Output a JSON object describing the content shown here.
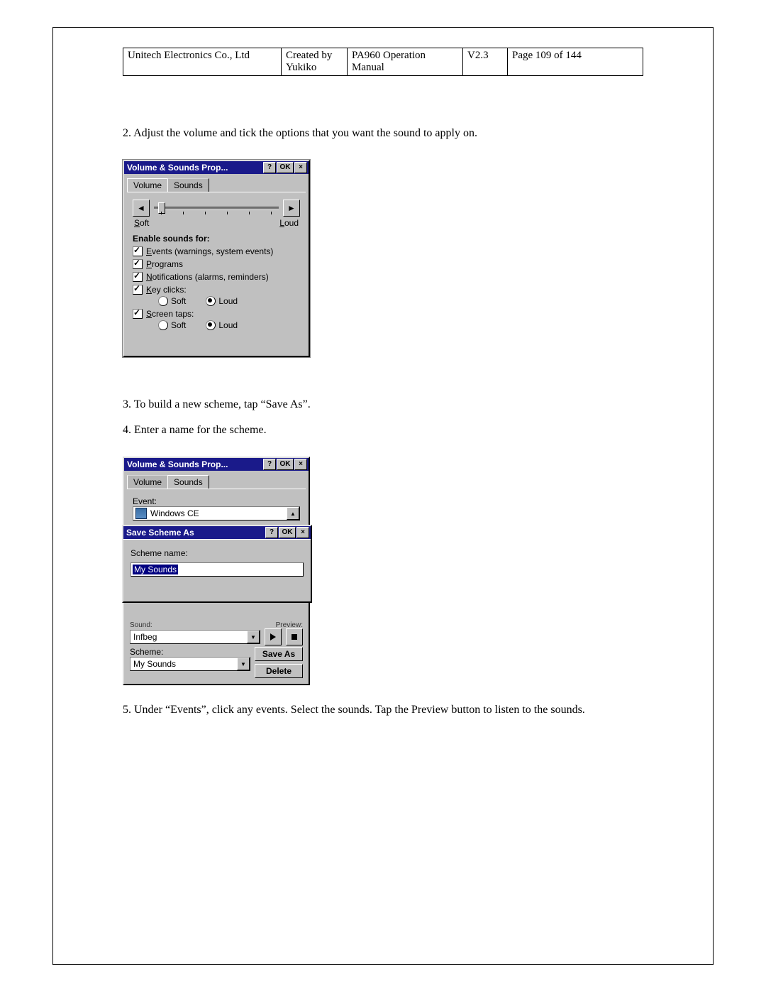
{
  "header": {
    "company": "Unitech Electronics Co., Ltd",
    "created": "Created by Yukiko",
    "doc": "PA960 Operation Manual",
    "version": "V2.3",
    "page": "Page 109 of 144"
  },
  "steps": {
    "s2": "2. Adjust the volume and tick the options that you want the sound to apply on.",
    "s3": "3. To build a new scheme, tap “Save As”.",
    "s4": "4. Enter a name for the scheme.",
    "s5": "5. Under “Events”, click any events. Select the sounds. Tap the Preview button to listen to the sounds."
  },
  "figure1": {
    "title": "Volume & Sounds Prop...",
    "help": "?",
    "ok": "OK",
    "close": "×",
    "tab_volume": "Volume",
    "tab_sounds": "Sounds",
    "soft": "Soft",
    "loud": "Loud",
    "enable_label": "Enable sounds for:",
    "cb_events": "Events (warnings, system events)",
    "cb_programs": "Programs",
    "cb_notifications": "Notifications (alarms, reminders)",
    "cb_keyclicks": "Key clicks:",
    "cb_screentaps": "Screen taps:",
    "r_soft": "Soft",
    "r_loud": "Loud"
  },
  "figure2": {
    "title": "Volume & Sounds Prop...",
    "help": "?",
    "ok": "OK",
    "close": "×",
    "tab_volume": "Volume",
    "tab_sounds": "Sounds",
    "event_label": "Event:",
    "event_value": "Windows CE",
    "sub_title": "Save Scheme As",
    "scheme_name_label": "Scheme name:",
    "scheme_name_value": "My Sounds",
    "cut_sound": "Sound:",
    "cut_preview": "Preview:",
    "sound_value": "Infbeg",
    "scheme_label": "Scheme:",
    "scheme_value": "My Sounds",
    "btn_saveas": "Save As",
    "btn_delete": "Delete"
  }
}
